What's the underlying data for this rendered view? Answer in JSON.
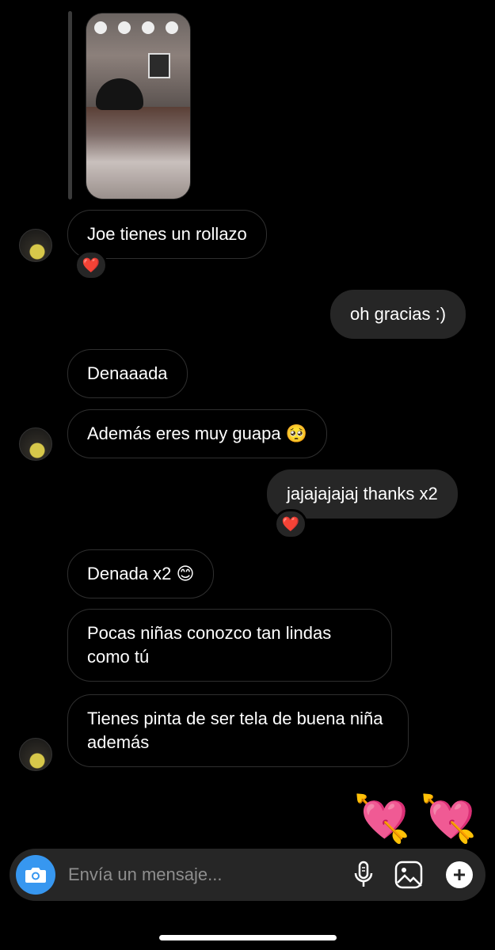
{
  "messages": [
    {
      "id": "m1",
      "direction": "in",
      "text": "Joe tienes un rollazo",
      "reaction": "❤️"
    },
    {
      "id": "m2",
      "direction": "out",
      "text": "oh gracias :)"
    },
    {
      "id": "m3",
      "direction": "in",
      "text": "Denaaada"
    },
    {
      "id": "m4",
      "direction": "in",
      "text": "Además eres muy guapa 🥺"
    },
    {
      "id": "m5",
      "direction": "out",
      "text": "jajajajajaj thanks x2",
      "reaction": "❤️"
    },
    {
      "id": "m6",
      "direction": "in",
      "text": "Denada x2 😊"
    },
    {
      "id": "m7",
      "direction": "in",
      "text": "Pocas niñas conozco tan lindas como tú"
    },
    {
      "id": "m8",
      "direction": "in",
      "text": "Tienes pinta de ser tela de buena niña además"
    }
  ],
  "stickers": [
    {
      "name": "heart-with-arrow",
      "glyph": "💘"
    },
    {
      "name": "heart-with-arrow",
      "glyph": "💘"
    }
  ],
  "composer": {
    "placeholder": "Envía un mensaje...",
    "icons": [
      "camera-icon",
      "microphone-icon",
      "gallery-icon",
      "plus-icon"
    ]
  },
  "colors": {
    "background": "#000000",
    "outgoing_bubble": "#262626",
    "incoming_border": "#2f2f2f",
    "camera_button": "#3797f0",
    "reaction_heart": "#e0245e"
  }
}
